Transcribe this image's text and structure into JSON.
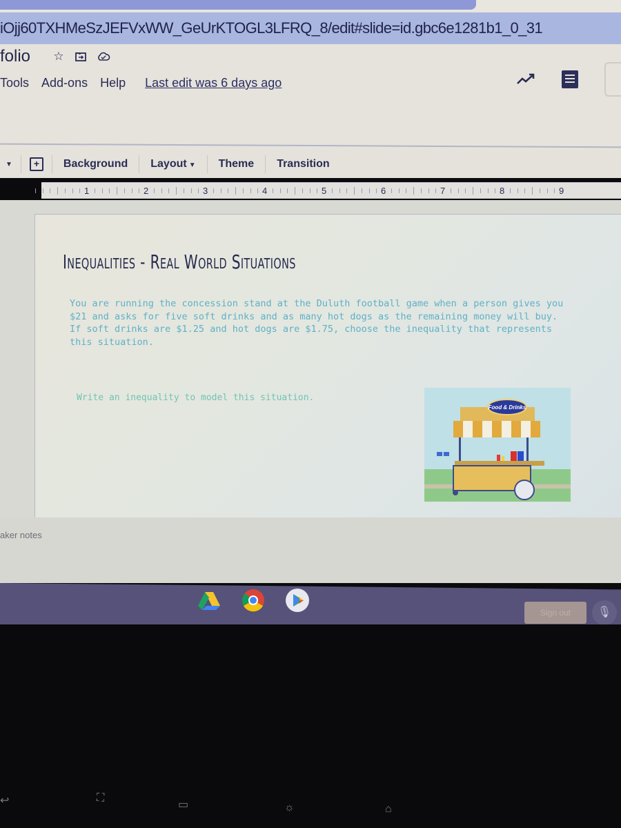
{
  "browser": {
    "url": "iOjj60TXHMeSzJEFVxWW_GeUrKTOGL3LFRQ_8/edit#slide=id.gbc6e1281b1_0_31"
  },
  "header": {
    "doc_title": "folio",
    "title_icons": [
      "star-icon",
      "move-to-folder-icon",
      "cloud-saved-icon"
    ],
    "menu": [
      "Tools",
      "Add-ons",
      "Help"
    ],
    "last_edit": "Last edit was 6 days ago",
    "right_icons": [
      "activity-icon",
      "comments-icon"
    ]
  },
  "toolbar": {
    "items": {
      "background": "Background",
      "layout": "Layout",
      "theme": "Theme",
      "transition": "Transition"
    }
  },
  "ruler": {
    "ticks": [
      "1",
      "2",
      "3",
      "4",
      "5",
      "6",
      "7",
      "8",
      "9"
    ]
  },
  "slide": {
    "title": "Inequalities - Real World Situations",
    "body": "You are running the concession stand at the Duluth football game when a person gives you $21 and asks for five soft drinks and as many hot dogs as the remaining money will buy.  If soft drinks are $1.25 and hot dogs are $1.75, choose the inequality that represents this situation.",
    "prompt": "Write an inequality to model this situation.",
    "image": {
      "description": "food cart illustration",
      "sign_text": "Food & Drinks"
    }
  },
  "notes": {
    "label": "aker notes"
  },
  "shelf": {
    "apps": [
      "Drive",
      "Chrome",
      "Play Store"
    ],
    "sign_out": "Sign out",
    "mic_icon": "microphone-icon"
  },
  "colors": {
    "url_bar": "#a9b6df",
    "header_bg": "#e6e3dc",
    "title_text": "#26294d",
    "body_text": "#5fb0c6",
    "shelf": "#56527a"
  }
}
